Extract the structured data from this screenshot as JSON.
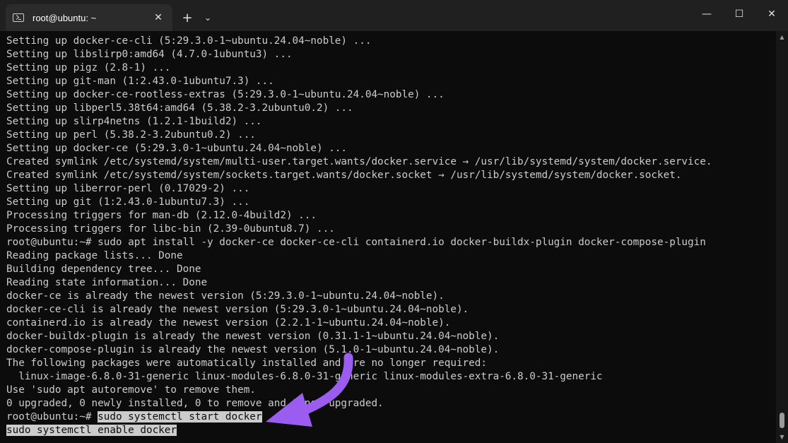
{
  "tab": {
    "title": "root@ubuntu: ~",
    "icon": "terminal-icon"
  },
  "titlebar": {
    "close_tab": "✕",
    "new_tab": "+",
    "dropdown": "⌄",
    "minimize": "—",
    "maximize": "☐",
    "close_window": "✕"
  },
  "terminal": {
    "lines": [
      "Setting up docker-ce-cli (5:29.3.0-1~ubuntu.24.04~noble) ...",
      "Setting up libslirp0:amd64 (4.7.0-1ubuntu3) ...",
      "Setting up pigz (2.8-1) ...",
      "Setting up git-man (1:2.43.0-1ubuntu7.3) ...",
      "Setting up docker-ce-rootless-extras (5:29.3.0-1~ubuntu.24.04~noble) ...",
      "Setting up libperl5.38t64:amd64 (5.38.2-3.2ubuntu0.2) ...",
      "Setting up slirp4netns (1.2.1-1build2) ...",
      "Setting up perl (5.38.2-3.2ubuntu0.2) ...",
      "Setting up docker-ce (5:29.3.0-1~ubuntu.24.04~noble) ...",
      "Created symlink /etc/systemd/system/multi-user.target.wants/docker.service → /usr/lib/systemd/system/docker.service.",
      "Created symlink /etc/systemd/system/sockets.target.wants/docker.socket → /usr/lib/systemd/system/docker.socket.",
      "Setting up liberror-perl (0.17029-2) ...",
      "Setting up git (1:2.43.0-1ubuntu7.3) ...",
      "Processing triggers for man-db (2.12.0-4build2) ...",
      "Processing triggers for libc-bin (2.39-0ubuntu8.7) ...",
      "root@ubuntu:~# sudo apt install -y docker-ce docker-ce-cli containerd.io docker-buildx-plugin docker-compose-plugin",
      "Reading package lists... Done",
      "Building dependency tree... Done",
      "Reading state information... Done",
      "docker-ce is already the newest version (5:29.3.0-1~ubuntu.24.04~noble).",
      "docker-ce-cli is already the newest version (5:29.3.0-1~ubuntu.24.04~noble).",
      "containerd.io is already the newest version (2.2.1-1~ubuntu.24.04~noble).",
      "docker-buildx-plugin is already the newest version (0.31.1-1~ubuntu.24.04~noble).",
      "docker-compose-plugin is already the newest version (5.1.0-1~ubuntu.24.04~noble).",
      "The following packages were automatically installed and are no longer required:",
      "  linux-image-6.8.0-31-generic linux-modules-6.8.0-31-generic linux-modules-extra-6.8.0-31-generic",
      "Use 'sudo apt autoremove' to remove them.",
      "0 upgraded, 0 newly installed, 0 to remove and 0 not upgraded."
    ],
    "prompt": "root@ubuntu:~# ",
    "selected_command_1": "sudo systemctl start docker",
    "selected_command_2": "sudo systemctl enable docker"
  },
  "annotation": {
    "arrow_color": "#9b5cf0"
  },
  "scrollbar": {
    "up": "▲",
    "down": "▼",
    "position": 0.97
  }
}
